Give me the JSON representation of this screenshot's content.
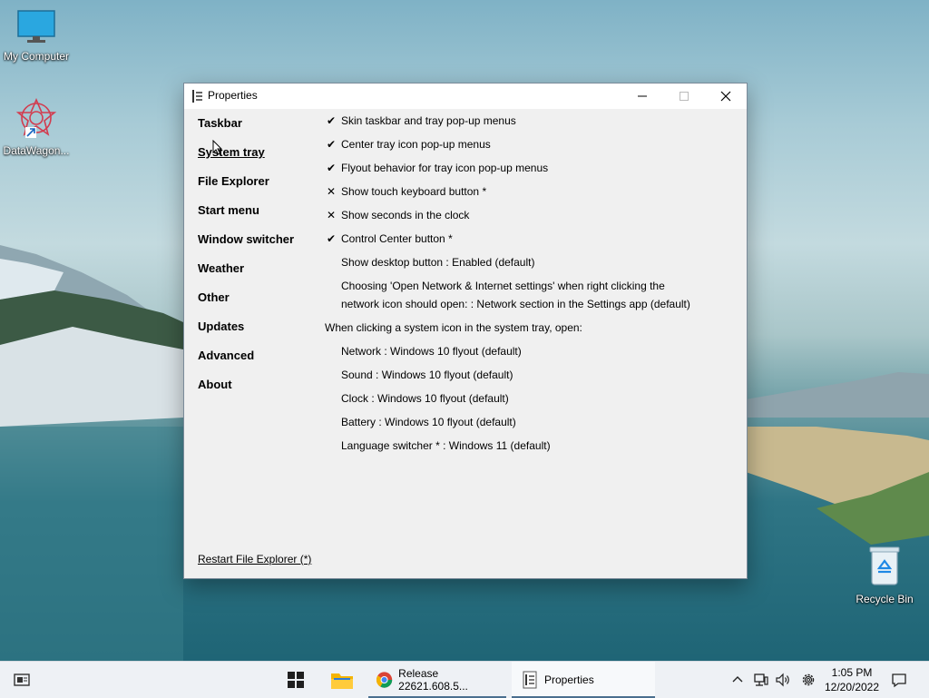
{
  "desktop": {
    "icons": [
      {
        "label": "My Computer"
      },
      {
        "label": "DataWagon..."
      },
      {
        "label": "Recycle Bin"
      }
    ]
  },
  "window": {
    "title": "Properties",
    "nav": [
      {
        "label": "Taskbar"
      },
      {
        "label": "System tray"
      },
      {
        "label": "File Explorer"
      },
      {
        "label": "Start menu"
      },
      {
        "label": "Window switcher"
      },
      {
        "label": "Weather"
      },
      {
        "label": "Other"
      },
      {
        "label": "Updates"
      },
      {
        "label": "Advanced"
      },
      {
        "label": "About"
      }
    ],
    "settings": [
      {
        "mark": "✔",
        "text": "Skin taskbar and tray pop-up menus"
      },
      {
        "mark": "✔",
        "text": "Center tray icon pop-up menus"
      },
      {
        "mark": "✔",
        "text": "Flyout behavior for tray icon pop-up menus"
      },
      {
        "mark": "✕",
        "text": "Show touch keyboard button *"
      },
      {
        "mark": "✕",
        "text": "Show seconds in the clock"
      },
      {
        "mark": "✔",
        "text": "Control Center button *"
      },
      {
        "mark": "",
        "text": "Show desktop button : Enabled (default)"
      },
      {
        "mark": "",
        "text": "Choosing 'Open Network & Internet settings' when right clicking the"
      },
      {
        "mark": "",
        "text": "network icon should open: : Network section in the Settings app (default)"
      }
    ],
    "section_heading": "When clicking a system icon in the system tray, open:",
    "tray_settings": [
      {
        "text": "Network : Windows 10 flyout (default)"
      },
      {
        "text": "Sound : Windows 10 flyout (default)"
      },
      {
        "text": "Clock : Windows 10 flyout (default)"
      },
      {
        "text": "Battery : Windows 10 flyout (default)"
      },
      {
        "text": "Language switcher * : Windows 11 (default)"
      }
    ],
    "restart_link": "Restart File Explorer (*)"
  },
  "taskbar": {
    "apps": [
      {
        "label": "Release 22621.608.5..."
      },
      {
        "label": "Properties"
      }
    ],
    "clock_time": "1:05 PM",
    "clock_date": "12/20/2022"
  },
  "colors": {
    "accent": "#4a6f8f",
    "window_bg": "#f0f0f0"
  }
}
